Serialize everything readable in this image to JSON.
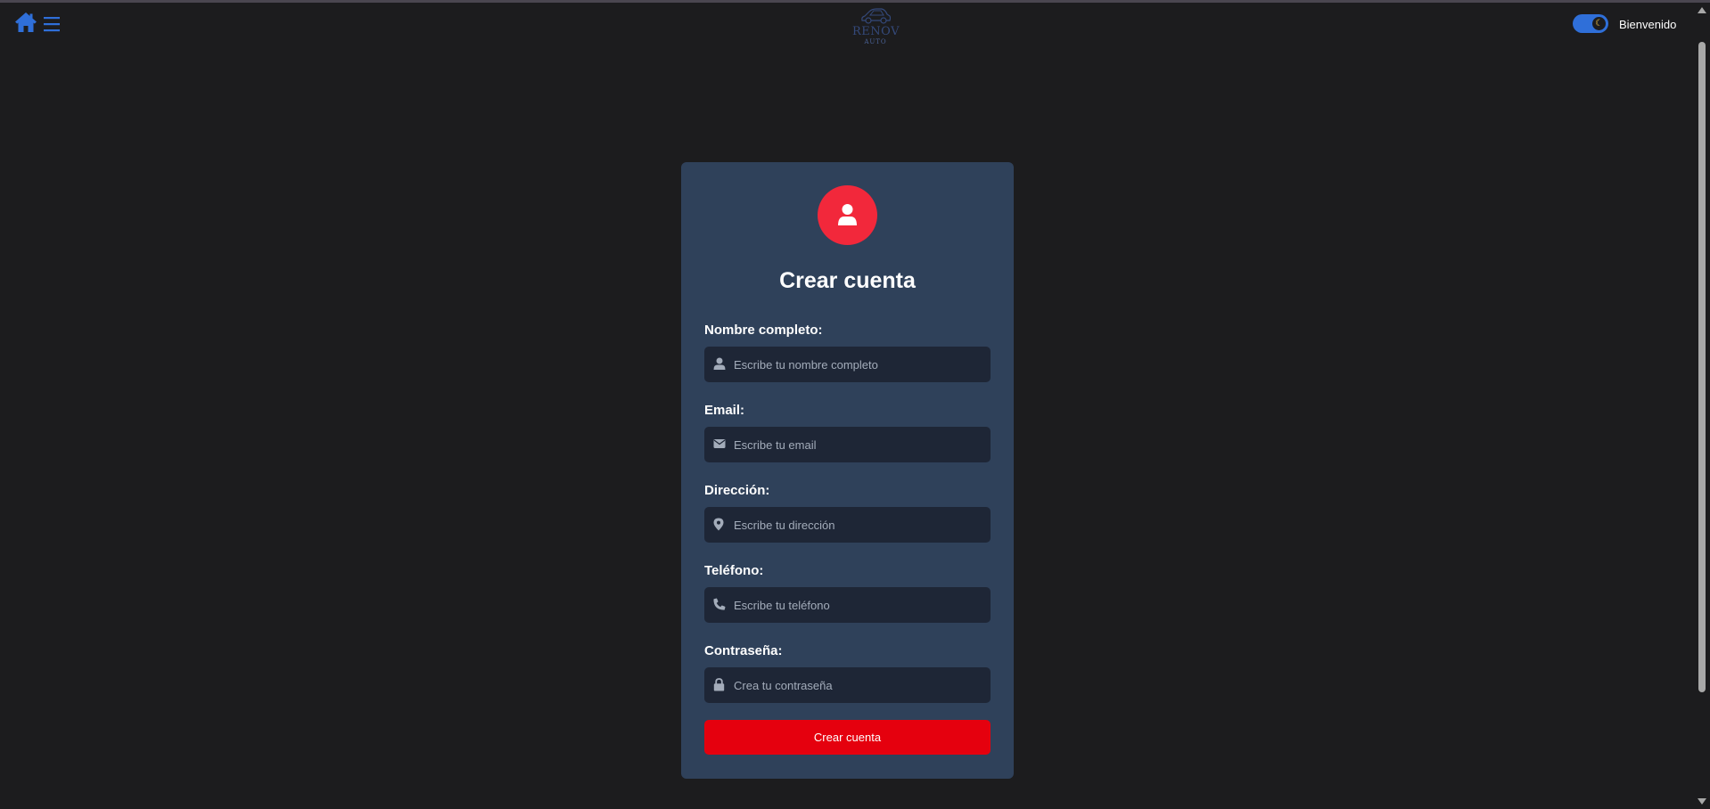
{
  "navbar": {
    "logo_name": "RENOV",
    "logo_sub": "AUTO",
    "welcome_text": "Bienvenido"
  },
  "form": {
    "title": "Crear cuenta",
    "fields": [
      {
        "label": "Nombre completo:",
        "placeholder": "Escribe tu nombre completo",
        "value": "",
        "icon": "user-icon"
      },
      {
        "label": "Email:",
        "placeholder": "Escribe tu email",
        "value": "",
        "icon": "envelope-icon"
      },
      {
        "label": "Dirección:",
        "placeholder": "Escribe tu dirección",
        "value": "",
        "icon": "map-marker-icon"
      },
      {
        "label": "Teléfono:",
        "placeholder": "Escribe tu teléfono",
        "value": "",
        "icon": "phone-icon"
      },
      {
        "label": "Contraseña:",
        "placeholder": "Crea tu contraseña",
        "value": "",
        "icon": "lock-icon"
      }
    ],
    "submit_label": "Crear cuenta"
  },
  "colors": {
    "background": "#1c1c1e",
    "card": "#2f415a",
    "input": "#1e2636",
    "accent_red": "#e5000e",
    "avatar_red": "#f2283b",
    "nav_blue": "#2f6fd9"
  }
}
